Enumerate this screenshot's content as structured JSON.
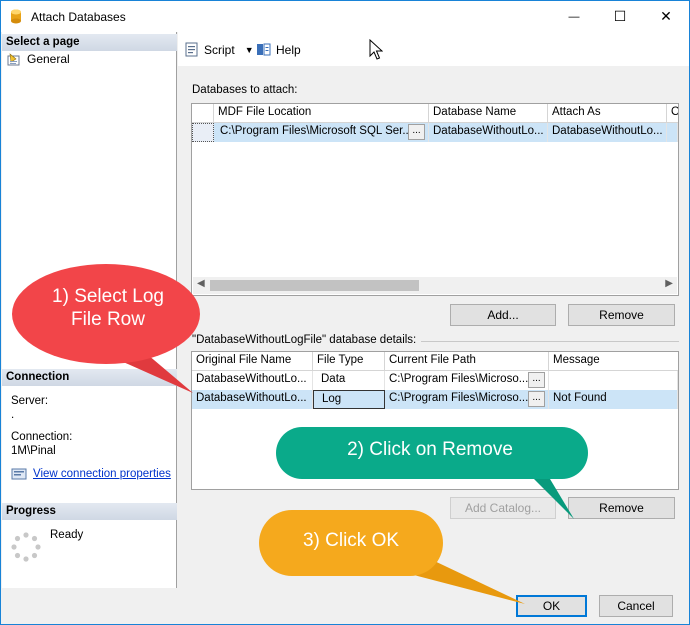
{
  "window": {
    "title": "Attach Databases",
    "minimize_glyph": "—",
    "maximize_glyph": "☐",
    "close_glyph": "✕"
  },
  "left_pane": {
    "select_page_heading": "Select a page",
    "pages": [
      {
        "label": "General",
        "icon": "general-page-icon"
      }
    ],
    "connection_heading": "Connection",
    "server_label": "Server:",
    "server_value": ".",
    "connection_label": "Connection:",
    "connection_value": "1M\\Pinal",
    "view_connection_link": "View connection properties",
    "progress_heading": "Progress",
    "progress_status": "Ready"
  },
  "toolbar": {
    "script_label": "Script",
    "help_label": "Help"
  },
  "databases_to_attach": {
    "group_label": "Databases to attach:",
    "columns": [
      "MDF File Location",
      "Database Name",
      "Attach As",
      "O"
    ],
    "rows": [
      {
        "location": "C:\\Program Files\\Microsoft SQL Ser...",
        "ellipsis": "...",
        "database_name": "DatabaseWithoutLo...",
        "attach_as": "DatabaseWithoutLo..."
      }
    ],
    "add_button": "Add...",
    "remove_button": "Remove"
  },
  "database_details": {
    "group_label": "\"DatabaseWithoutLogFile\" database details:",
    "columns": [
      "Original File Name",
      "File Type",
      "Current File Path",
      "Message"
    ],
    "rows": [
      {
        "original": "DatabaseWithoutLo...",
        "file_type": "Data",
        "path": "C:\\Program Files\\Microso...",
        "ellipsis": "...",
        "message": ""
      },
      {
        "original": "DatabaseWithoutLo...",
        "file_type": "Log",
        "path": "C:\\Program Files\\Microso...",
        "ellipsis": "...",
        "message": "Not Found"
      }
    ],
    "add_catalog_button": "Add Catalog...",
    "remove_button": "Remove"
  },
  "footer": {
    "ok_button": "OK",
    "cancel_button": "Cancel"
  },
  "callouts": {
    "step1_line1": "1) Select Log",
    "step1_line2": "File Row",
    "step2": "2) Click on Remove",
    "step3": "3) Click OK"
  },
  "colors": {
    "selection": "#cce4f7",
    "callout_red": "#f24549",
    "callout_green": "#0aaa8a",
    "callout_orange": "#f5a91d",
    "link": "#0033cc"
  }
}
